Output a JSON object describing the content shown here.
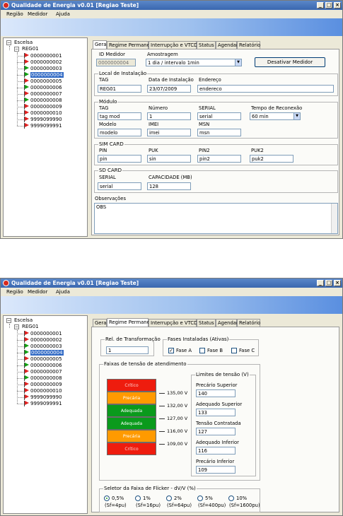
{
  "colors": {
    "critico": "#ee1c0e",
    "precario": "#ff9a00",
    "adequado": "#0a9a1c",
    "tree_flag_red": "#e02020",
    "tree_flag_green": "#10a010"
  },
  "window1": {
    "title": "Qualidade de Energia v0.01 [Regiao Teste]",
    "menu": [
      "Região",
      "Medidor",
      "Ajuda"
    ]
  },
  "window2": {
    "title": "Qualidade de Energia v0.01 [Regiao Teste]",
    "menu": [
      "Região",
      "Medidor",
      "Ajuda"
    ]
  },
  "tree": {
    "root": "Escelsa",
    "region": "REG01",
    "meters": [
      {
        "id": "0000000001",
        "flag": "red"
      },
      {
        "id": "0000000002",
        "flag": "red"
      },
      {
        "id": "0000000003",
        "flag": "green"
      },
      {
        "id": "0000000004",
        "flag": "green",
        "selected": true
      },
      {
        "id": "0000000005",
        "flag": "red"
      },
      {
        "id": "0000000006",
        "flag": "green"
      },
      {
        "id": "0000000007",
        "flag": "red"
      },
      {
        "id": "0000000008",
        "flag": "green"
      },
      {
        "id": "0000000009",
        "flag": "red"
      },
      {
        "id": "0000000010",
        "flag": "red"
      },
      {
        "id": "9999099990",
        "flag": "red"
      },
      {
        "id": "9999099991",
        "flag": "red"
      }
    ]
  },
  "tabs": [
    "Geral",
    "Regime Permanente",
    "Interrupção e VTCD",
    "Status",
    "Agendar",
    "Relatório"
  ],
  "geral": {
    "id_medidor_label": "ID Medidor",
    "id_medidor_value": "0000000004",
    "amostragem_label": "Amostragem",
    "amostragem_value": "1 dia / intervalo 1min",
    "desativar_button": "Desativar Medidor",
    "local_title": "Local de Instalação",
    "tag_label": "TAG",
    "tag_value": "REG01",
    "data_label": "Data de Instalação",
    "data_value": "23/07/2009",
    "endereco_label": "Endereço",
    "endereco_value": "endereco",
    "modulo_title": "Módulo",
    "mod_tag_label": "TAG",
    "mod_tag_value": "tag mod",
    "numero_label": "Número",
    "numero_value": "1",
    "serial_label": "SERIAL",
    "serial_value": "serial",
    "reconexao_label": "Tempo de Reconexão",
    "reconexao_value": "60 min",
    "modelo_label": "Modelo",
    "modelo_value": "modelo",
    "imei_label": "IMEI",
    "imei_value": "imei",
    "msn_label": "MSN",
    "msn_value": "msn",
    "sim_title": "SIM CARD",
    "pin_label": "PIN",
    "pin_value": "pin",
    "puk_label": "PUK",
    "puk_value": "sin",
    "pin2_label": "PIN2",
    "pin2_value": "pin2",
    "puk2_label": "PUK2",
    "puk2_value": "puk2",
    "sd_title": "SD CARD",
    "sd_serial_label": "SERIAL",
    "sd_serial_value": "serial",
    "capacidade_label": "CAPACIDADE (MB)",
    "capacidade_value": "128",
    "obs_label": "Observações",
    "obs_value": "OBS"
  },
  "regime": {
    "rel_title": "Rel. de Transformação",
    "rel_value": "1",
    "fases_title": "Fases Instaladas (Ativas)",
    "fase_a": "Fase A",
    "fase_a_checked": true,
    "fase_b": "Fase B",
    "fase_b_checked": false,
    "fase_c": "Fase C",
    "fase_c_checked": false,
    "faixas_title": "Faixas de tensão de atendimento",
    "bands": [
      {
        "label": "Crítico",
        "class": "critico"
      },
      {
        "label": "Precária",
        "class": "precario"
      },
      {
        "label": "Adequada",
        "class": "adequado"
      },
      {
        "label": "Adequada",
        "class": "adequado"
      },
      {
        "label": "Precária",
        "class": "precario"
      },
      {
        "label": "Crítico",
        "class": "critico"
      }
    ],
    "thresholds": [
      "135,00 V",
      "132,00 V",
      "127,00 V",
      "116,00 V",
      "109,00 V"
    ],
    "limites_title": "Limites de tensão (V)",
    "precario_sup_label": "Precário Superior",
    "precario_sup_value": "140",
    "adequado_sup_label": "Adequado Superior",
    "adequado_sup_value": "133",
    "tensao_contr_label": "Tensão Contratada",
    "tensao_contr_value": "127",
    "adequado_inf_label": "Adequado Inferior",
    "adequado_inf_value": "116",
    "precario_inf_label": "Precário Inferior",
    "precario_inf_value": "109",
    "flicker_title": "Seletor da Faixa de Flicker - dV/V (%)",
    "flicker_options": [
      {
        "pct": "0,5%",
        "sf": "(Sf=4pu)",
        "checked": true
      },
      {
        "pct": "1%",
        "sf": "(Sf=16pu)",
        "checked": false
      },
      {
        "pct": "2%",
        "sf": "(Sf=64pu)",
        "checked": false
      },
      {
        "pct": "5%",
        "sf": "(Sf=400pu)",
        "checked": false
      },
      {
        "pct": "10%",
        "sf": "(Sf=1600pu)",
        "checked": false
      }
    ]
  }
}
